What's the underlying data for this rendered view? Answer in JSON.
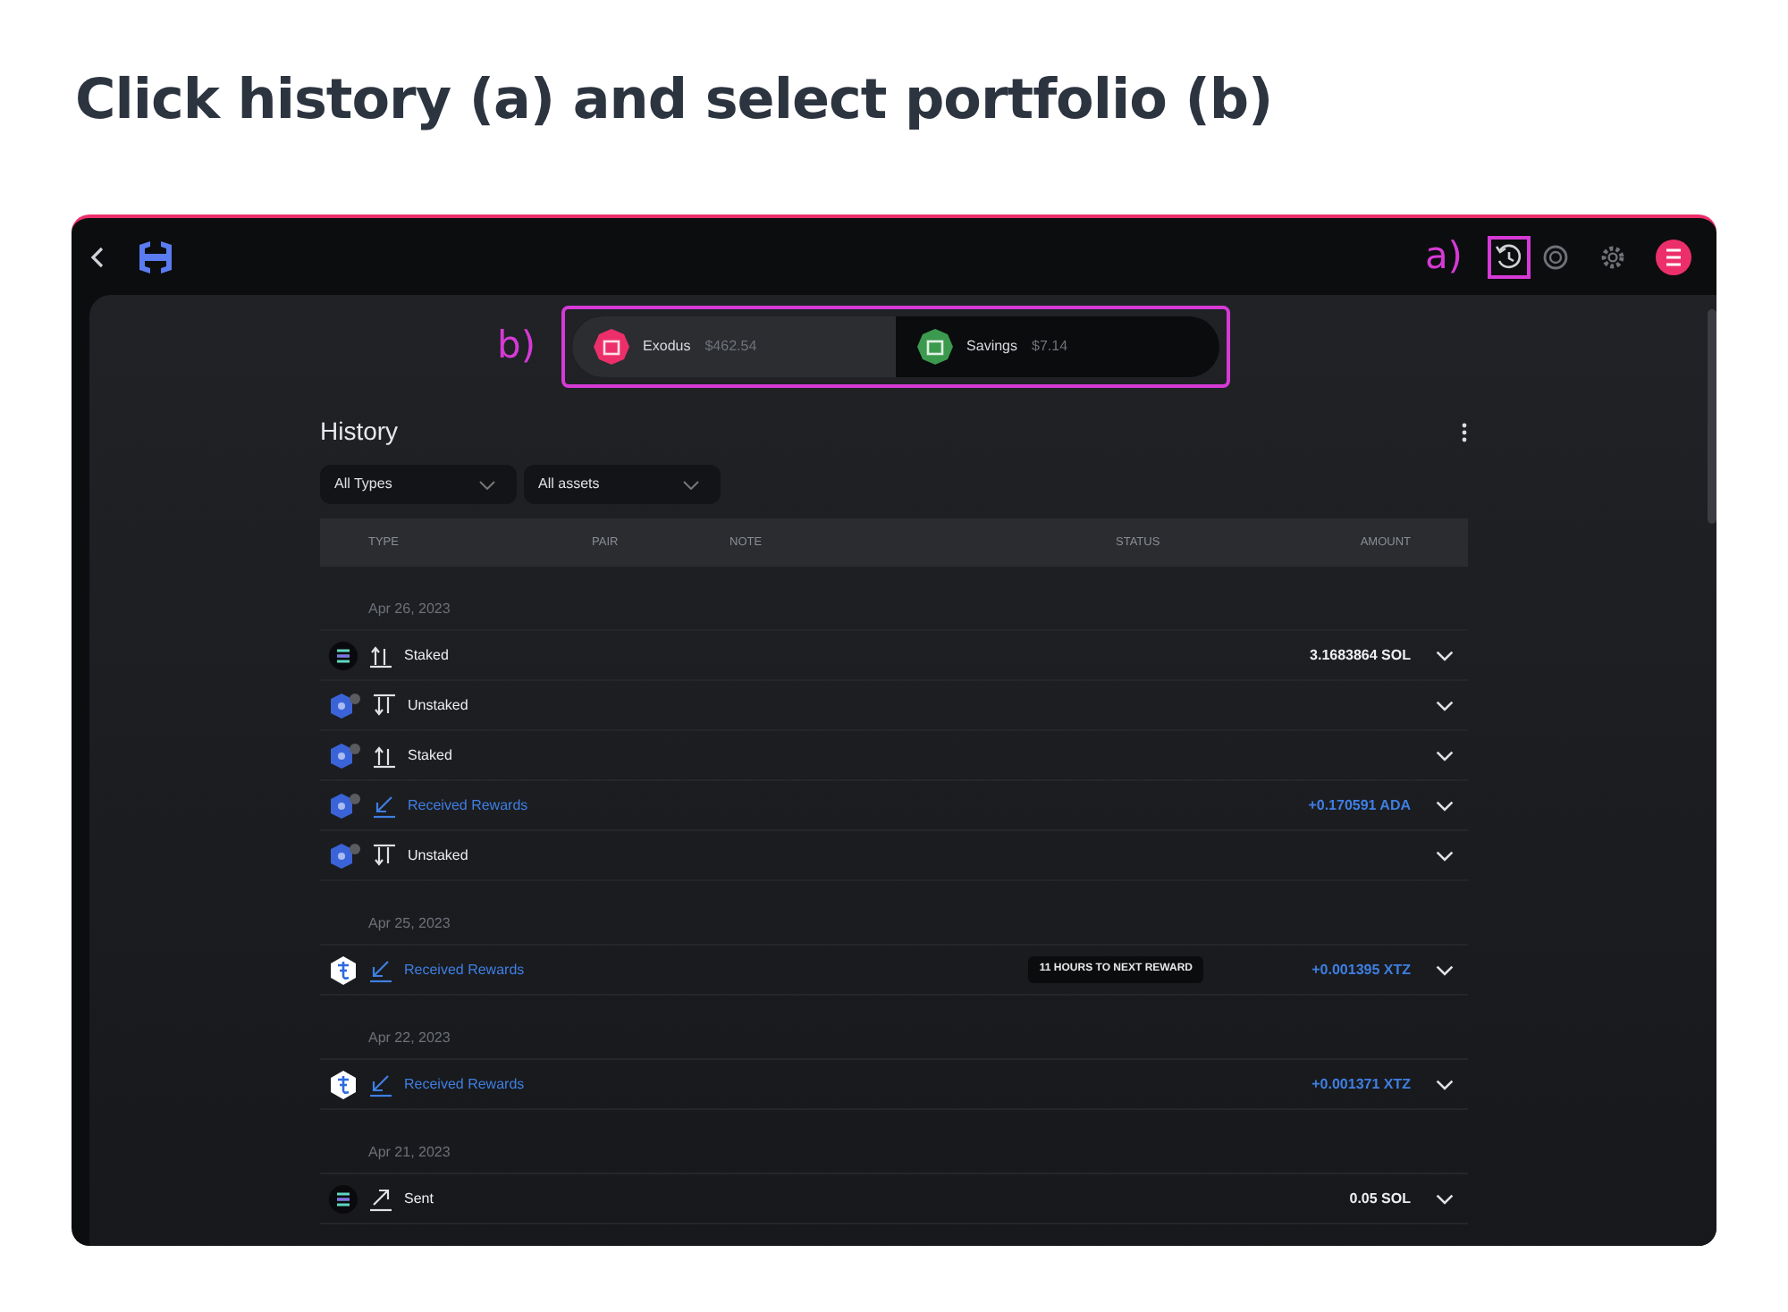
{
  "heading": "Click history (a) and select portfolio (b)",
  "callouts": {
    "history": "a)",
    "portfolio": "b)"
  },
  "portfolios": [
    {
      "name": "Exodus",
      "balance": "$462.54",
      "selected": true,
      "color": "#ec2f6a"
    },
    {
      "name": "Savings",
      "balance": "$7.14",
      "selected": false,
      "color": "#3c9a4e"
    }
  ],
  "history": {
    "title": "History",
    "filters": [
      "All Types",
      "All assets"
    ],
    "columns": [
      "TYPE",
      "PAIR",
      "NOTE",
      "STATUS",
      "AMOUNT"
    ],
    "groups": [
      {
        "date": "Apr 26, 2023",
        "rows": [
          {
            "coin": {
              "kind": "sol"
            },
            "kind": "staked",
            "label": "Staked",
            "amount": "3.1683864 SOL"
          },
          {
            "coin": {
              "kind": "ada"
            },
            "kind": "unstaked",
            "label": "Unstaked"
          },
          {
            "coin": {
              "kind": "ada"
            },
            "kind": "staked",
            "label": "Staked"
          },
          {
            "coin": {
              "kind": "ada"
            },
            "kind": "reward",
            "label": "Received Rewards",
            "amount": "+0.170591 ADA"
          },
          {
            "coin": {
              "kind": "ada"
            },
            "kind": "unstaked",
            "label": "Unstaked"
          }
        ]
      },
      {
        "date": "Apr 25, 2023",
        "rows": [
          {
            "coin": {
              "kind": "xtz"
            },
            "kind": "reward",
            "label": "Received Rewards",
            "status": "11 HOURS TO NEXT REWARD",
            "amount": "+0.001395 XTZ"
          }
        ]
      },
      {
        "date": "Apr 22, 2023",
        "rows": [
          {
            "coin": {
              "kind": "xtz"
            },
            "kind": "reward",
            "label": "Received Rewards",
            "amount": "+0.001371 XTZ"
          }
        ]
      },
      {
        "date": "Apr 21, 2023",
        "rows": [
          {
            "coin": {
              "kind": "sol"
            },
            "kind": "sent",
            "label": "Sent",
            "amount": "0.05 SOL"
          }
        ]
      }
    ]
  }
}
